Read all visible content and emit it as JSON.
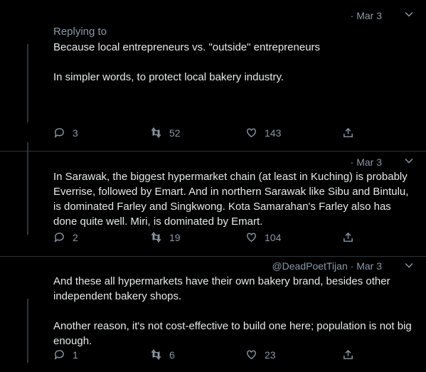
{
  "tweets": [
    {
      "handle": "",
      "date": "Mar 3",
      "replying_label": "Replying to",
      "paragraphs": [
        "Because local entrepreneurs vs. \"outside\" entrepreneurs",
        "In simpler words, to protect local bakery industry."
      ],
      "replies": "3",
      "retweets": "52",
      "likes": "143"
    },
    {
      "handle": "",
      "date": "Mar 3",
      "paragraphs": [
        "In Sarawak, the biggest hypermarket chain (at least in Kuching) is probably Everrise, followed by Emart. And in northern Sarawak like Sibu and Bintulu, is dominated Farley and Singkwong. Kota Samarahan's Farley also has done quite well. Miri, is dominated by Emart."
      ],
      "replies": "2",
      "retweets": "19",
      "likes": "104"
    },
    {
      "handle": "@DeadPoetTijan",
      "date": "Mar 3",
      "paragraphs": [
        "And these all hypermarkets have their own bakery brand, besides other independent bakery shops.",
        "Another reason, it's not cost-effective to build one here; population is not big enough."
      ],
      "replies": "1",
      "retweets": "6",
      "likes": "23"
    }
  ],
  "icons": {
    "reply": "reply-icon",
    "retweet": "retweet-icon",
    "like": "heart-icon",
    "share": "share-icon",
    "more": "chevron-down-icon"
  },
  "colors": {
    "background": "#000000",
    "text": "#e7e9ea",
    "muted": "#8b98a5",
    "divider": "#2f3336"
  }
}
